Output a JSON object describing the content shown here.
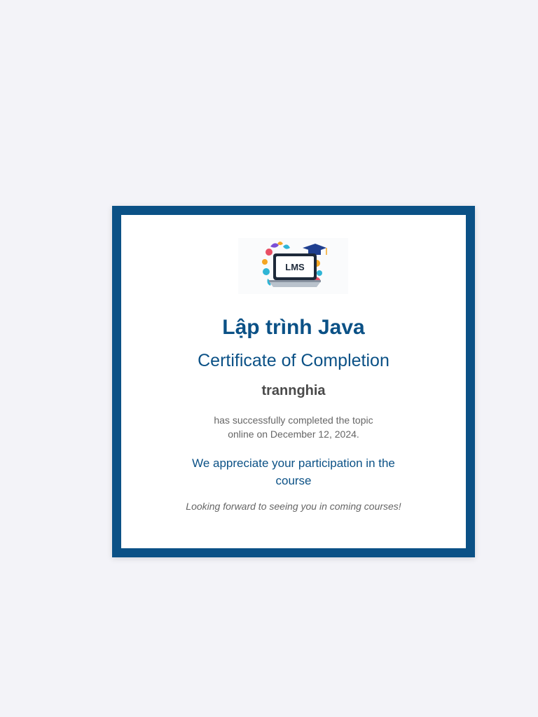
{
  "logo": {
    "text": "LMS",
    "icon": "lms-laptop-graduation-icon"
  },
  "certificate": {
    "course_title": "Lập trình Java",
    "heading": "Certificate of Completion",
    "recipient": "trannghia",
    "completion_line1": "has successfully completed the topic",
    "completion_line2": "online on December 12, 2024.",
    "appreciation": "We appreciate your participation in the course",
    "farewell": "Looking forward to seeing you in coming courses!"
  },
  "colors": {
    "frame": "#0b5186",
    "heading": "#0b5186",
    "recipient": "#4a4a4a",
    "body_text": "#666666",
    "page_background": "#f3f3f8"
  }
}
